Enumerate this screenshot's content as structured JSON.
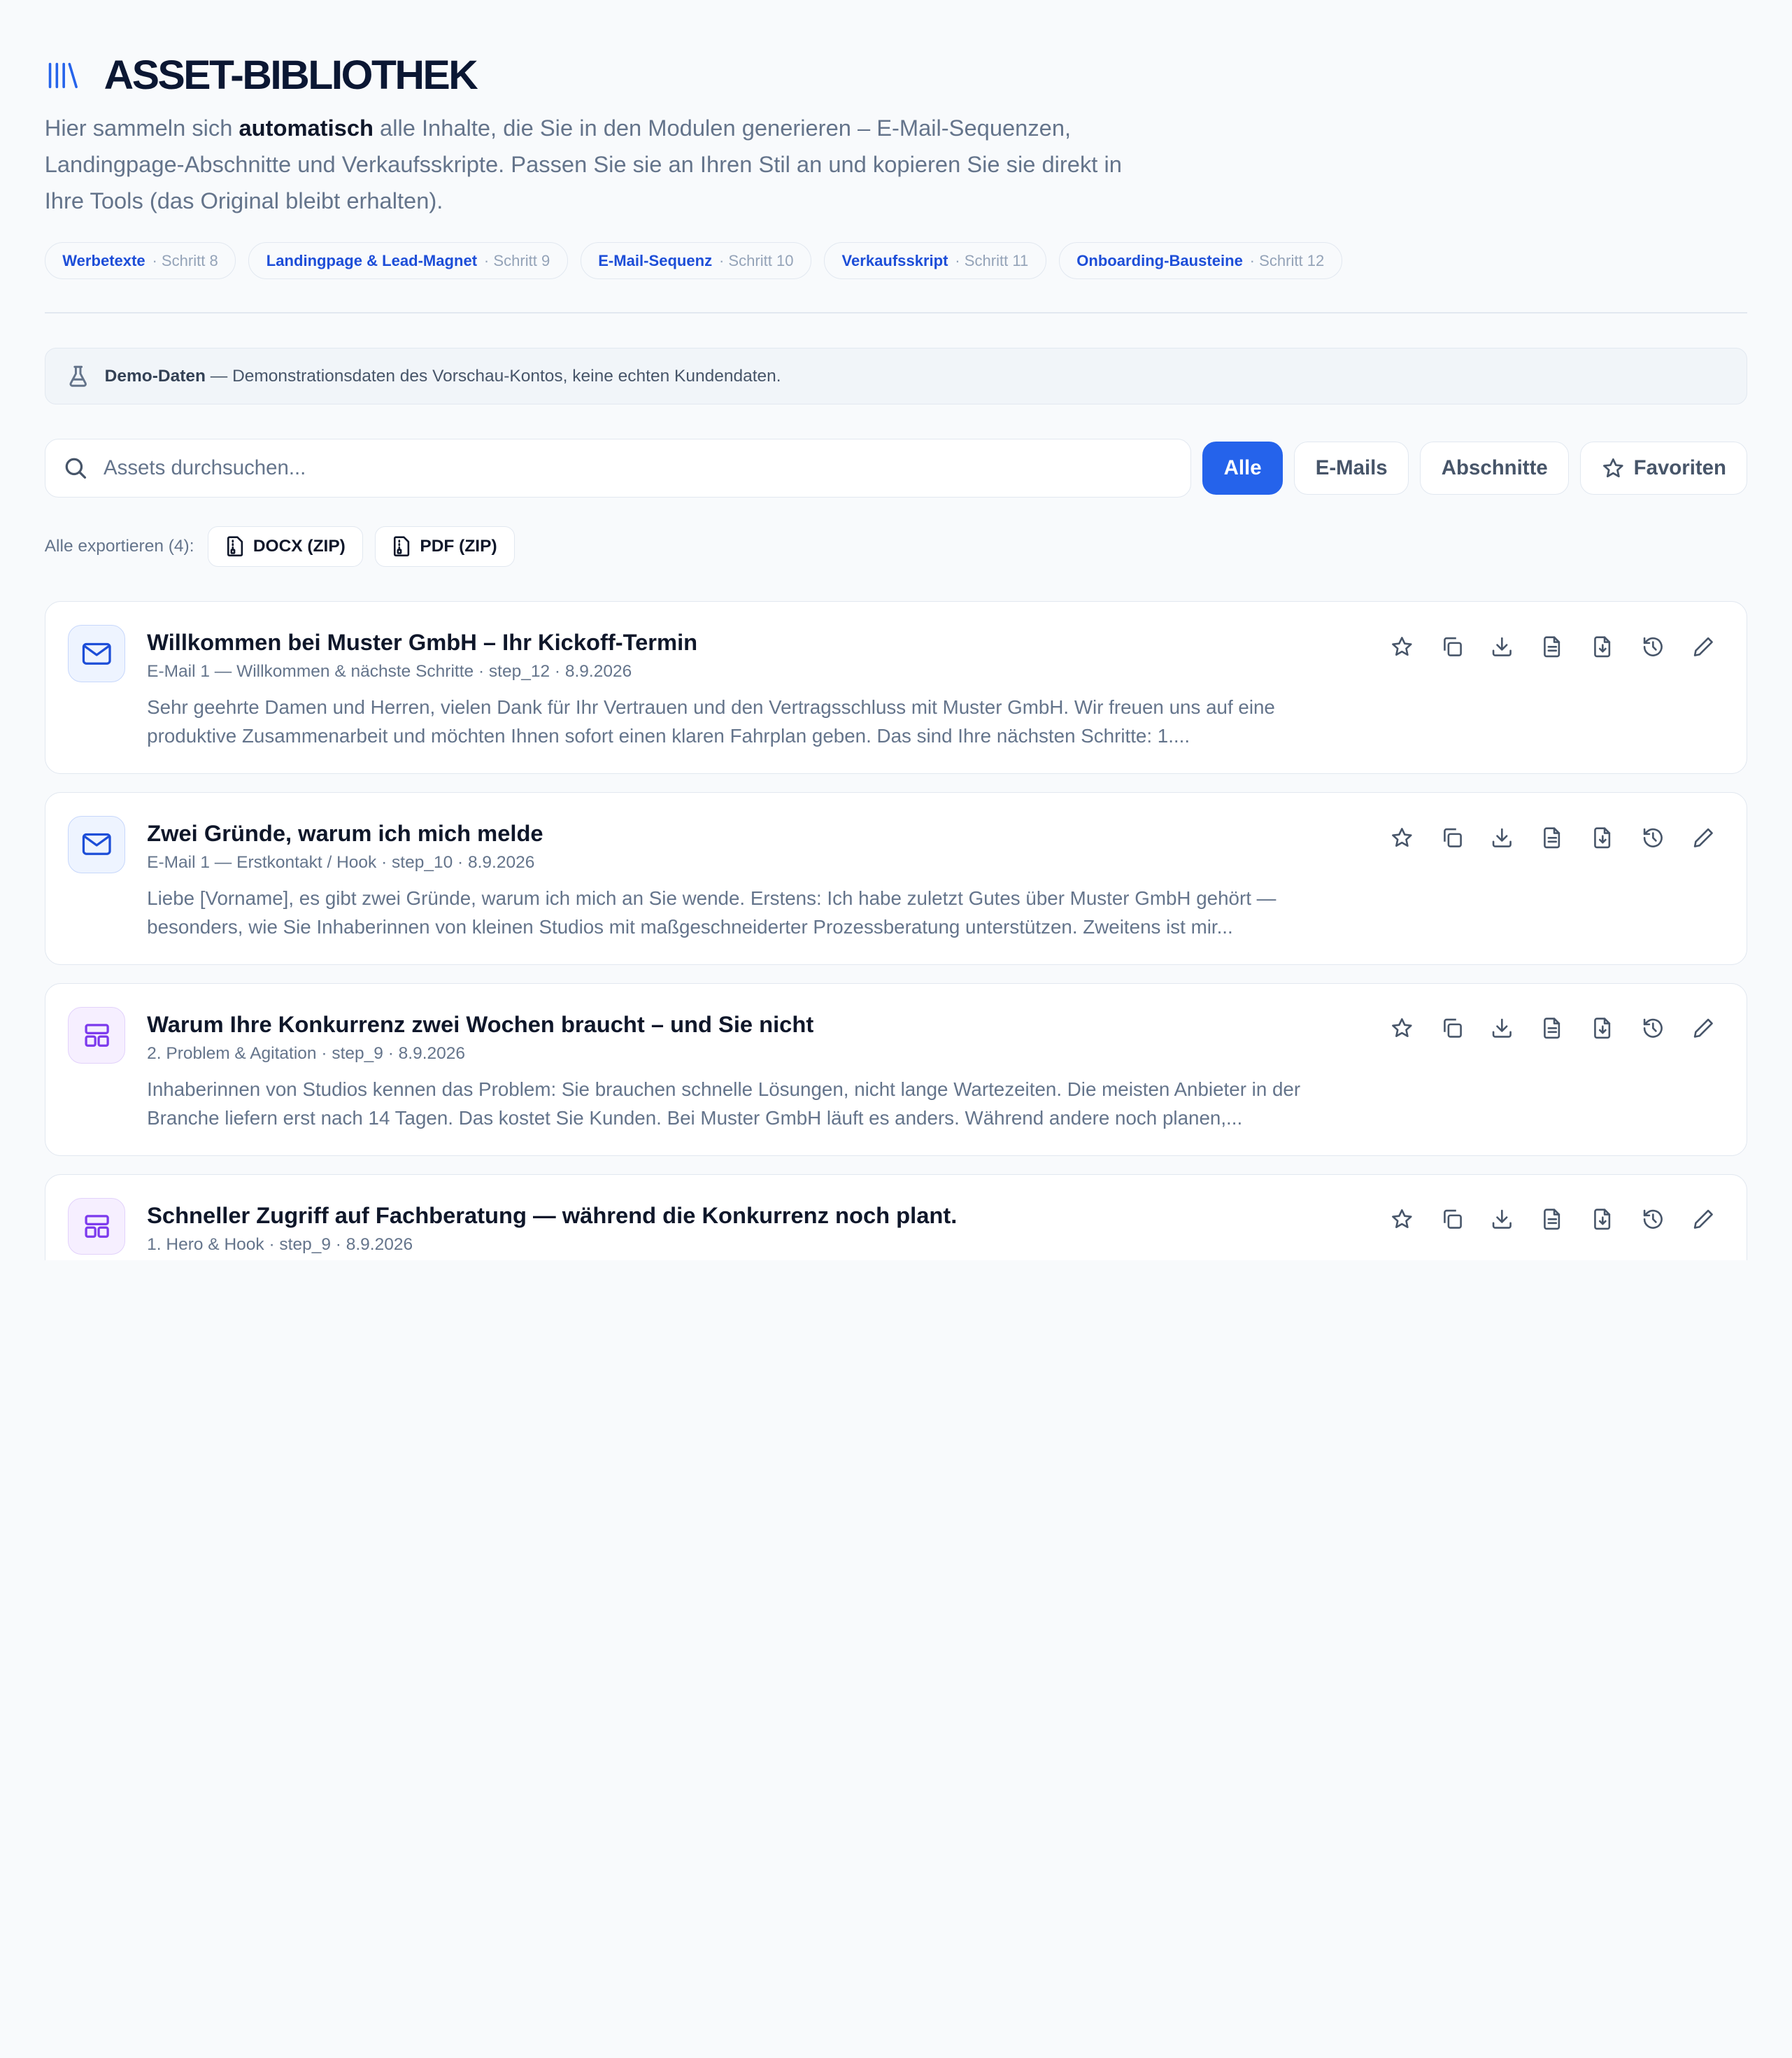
{
  "header": {
    "title": "ASSET-BIBLIOTHEK",
    "intro_before": "Hier sammeln sich ",
    "intro_bold": "automatisch",
    "intro_after": " alle Inhalte, die Sie in den Modulen generieren – E-Mail-Sequenzen, Landingpage-Abschnitte und Verkaufsskripte. Passen Sie sie an Ihren Stil an und kopieren Sie sie direkt in Ihre Tools (das Original bleibt erhalten).",
    "icon": "library-icon"
  },
  "steps": [
    {
      "name": "Werbetexte",
      "step": "· Schritt 8"
    },
    {
      "name": "Landingpage & Lead-Magnet",
      "step": "· Schritt 9"
    },
    {
      "name": "E-Mail-Sequenz",
      "step": "· Schritt 10"
    },
    {
      "name": "Verkaufsskript",
      "step": "· Schritt 11"
    },
    {
      "name": "Onboarding-Bausteine",
      "step": "· Schritt 12"
    }
  ],
  "demo": {
    "label": "Demo-Daten",
    "text": " — Demonstrationsdaten des Vorschau-Kontos, keine echten Kundendaten."
  },
  "search": {
    "placeholder": "Assets durchsuchen..."
  },
  "filters": [
    {
      "label": "Alle",
      "active": true
    },
    {
      "label": "E-Mails",
      "active": false
    },
    {
      "label": "Abschnitte",
      "active": false
    },
    {
      "label": "Favoriten",
      "active": false,
      "icon": "star-icon"
    }
  ],
  "export": {
    "label": "Alle exportieren (4):",
    "docx": "DOCX (ZIP)",
    "pdf": "PDF (ZIP)"
  },
  "assets": [
    {
      "kind": "email",
      "title": "Willkommen bei Muster GmbH – Ihr Kickoff-Termin",
      "meta": "E-Mail 1 — Willkommen & nächste Schritte · step_12 · 8.9.2026",
      "body": "Sehr geehrte Damen und Herren, vielen Dank für Ihr Vertrauen und den Vertragsschluss mit Muster GmbH. Wir freuen uns auf eine produktive Zusammenarbeit und möchten Ihnen sofort einen klaren Fahrplan geben. Das sind Ihre nächsten Schritte: 1...."
    },
    {
      "kind": "email",
      "title": "Zwei Gründe, warum ich mich melde",
      "meta": "E-Mail 1 — Erstkontakt / Hook · step_10 · 8.9.2026",
      "body": "Liebe [Vorname], es gibt zwei Gründe, warum ich mich an Sie wende. Erstens: Ich habe zuletzt Gutes über Muster GmbH gehört — besonders, wie Sie Inhaberinnen von kleinen Studios mit maßgeschneiderter Prozessberatung unterstützen. Zweitens ist mir..."
    },
    {
      "kind": "section",
      "title": "Warum Ihre Konkurrenz zwei Wochen braucht – und Sie nicht",
      "meta": "2. Problem & Agitation · step_9 · 8.9.2026",
      "body": "Inhaberinnen von Studios kennen das Problem: Sie brauchen schnelle Lösungen, nicht lange Wartezeiten. Die meisten Anbieter in der Branche liefern erst nach 14 Tagen. Das kostet Sie Kunden. Bei Muster GmbH läuft es anders. Während andere noch planen,..."
    },
    {
      "kind": "section",
      "title": "Schneller Zugriff auf Fachberatung — während die Konkurrenz noch plant.",
      "meta": "1. Hero & Hook · step_9 · 8.9.2026",
      "body": ""
    }
  ],
  "action_icons": [
    "star-icon",
    "copy-icon",
    "download-icon",
    "document-icon",
    "file-download-icon",
    "history-icon",
    "edit-icon"
  ],
  "colors": {
    "accent": "#2563eb",
    "step_text": "#1d4ed8",
    "email_icon": "#1d4ed8",
    "section_icon": "#7c3aed"
  }
}
